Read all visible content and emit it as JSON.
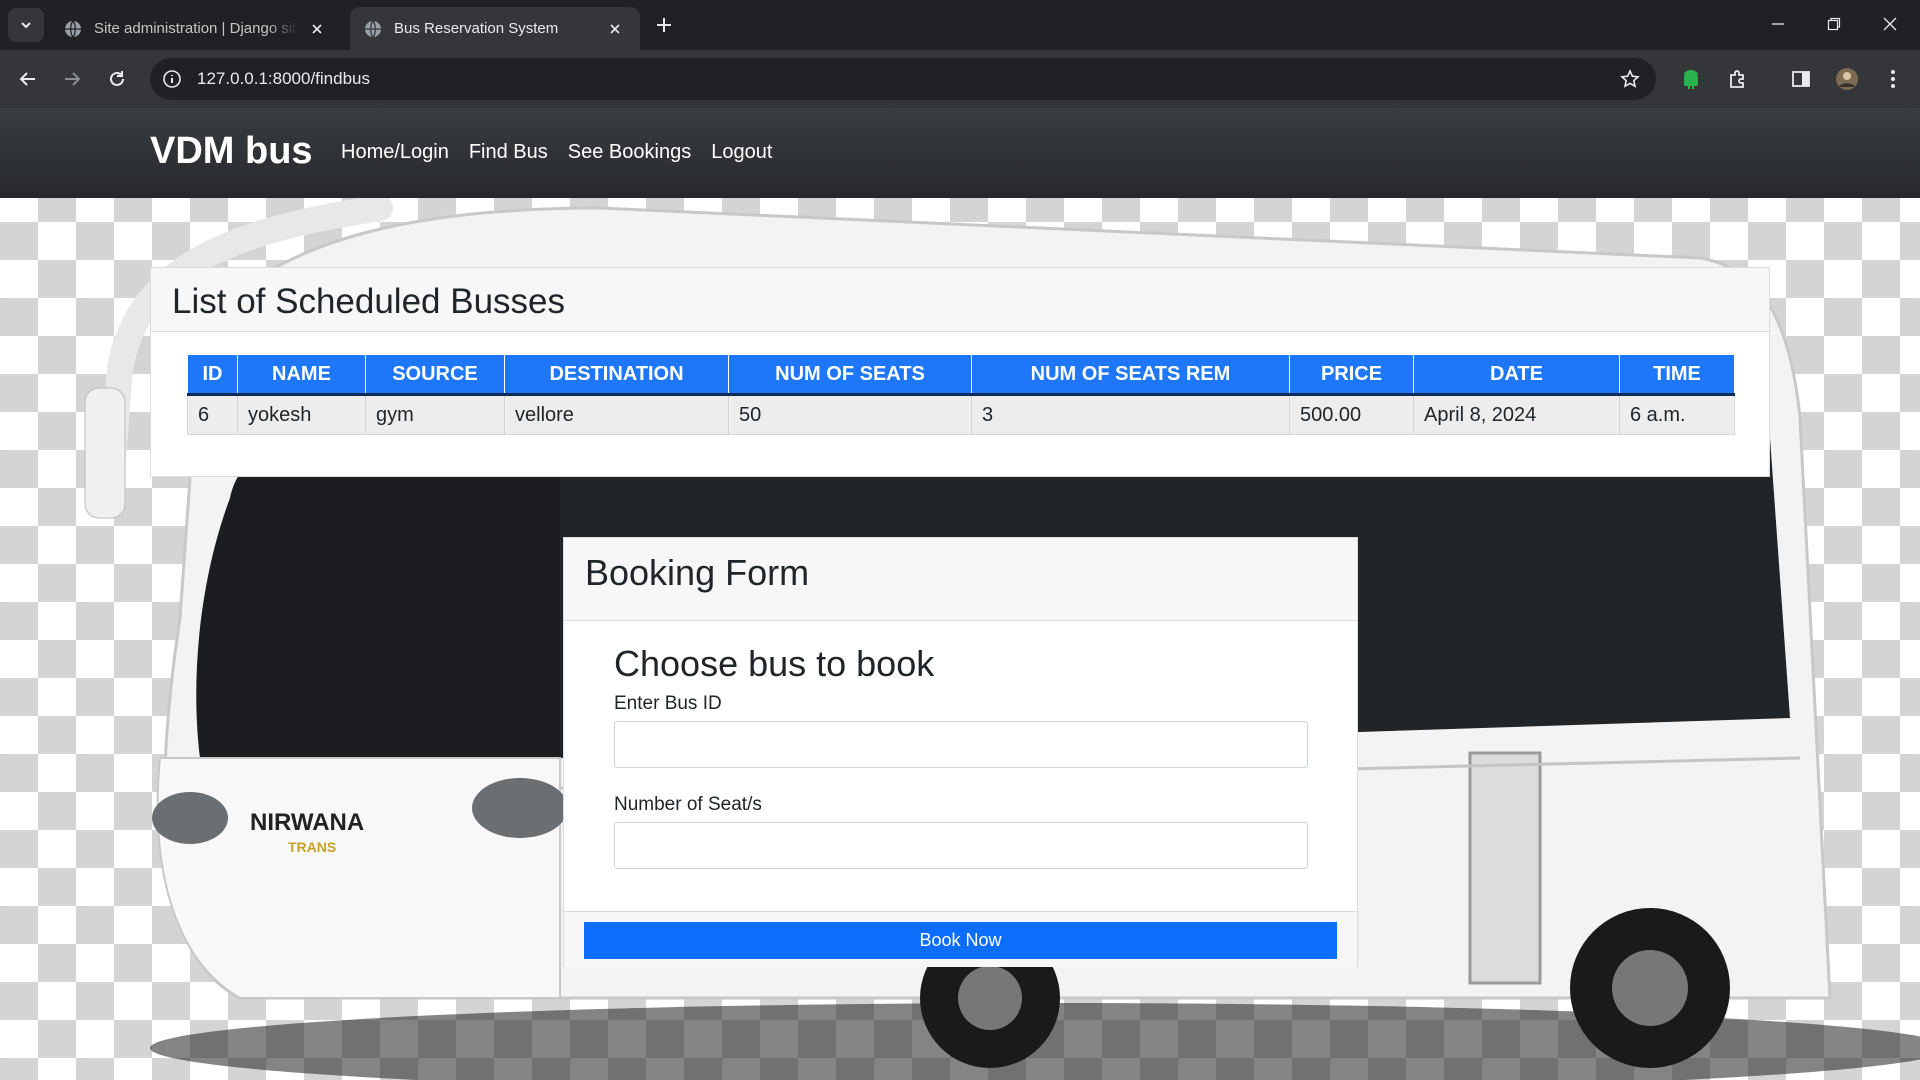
{
  "browser": {
    "tabs": [
      {
        "title": "Site administration | Django site admin",
        "active": false
      },
      {
        "title": "Bus Reservation System",
        "active": true
      }
    ],
    "url": "127.0.0.1:8000/findbus"
  },
  "site": {
    "brand": "VDM bus",
    "nav": [
      "Home/Login",
      "Find Bus",
      "See Bookings",
      "Logout"
    ]
  },
  "schedule": {
    "title": "List of Scheduled Busses",
    "columns": [
      "ID",
      "NAME",
      "SOURCE",
      "DESTINATION",
      "NUM OF SEATS",
      "NUM OF SEATS REM",
      "PRICE",
      "DATE",
      "TIME"
    ],
    "rows": [
      [
        "6",
        "yokesh",
        "gym",
        "vellore",
        "50",
        "3",
        "500.00",
        "April 8, 2024",
        "6 a.m."
      ]
    ]
  },
  "booking": {
    "header": "Booking Form",
    "heading": "Choose bus to book",
    "bus_id_label": "Enter Bus ID",
    "bus_id_value": "",
    "seats_label": "Number of Seat/s",
    "seats_value": "",
    "submit_label": "Book Now"
  },
  "background_image": {
    "brand_text": "NIRWANA",
    "sub_text": "TRANS"
  },
  "colors": {
    "navbar": "#2b2d30",
    "table_header": "#1e77f8",
    "primary_button": "#0d6efd"
  }
}
